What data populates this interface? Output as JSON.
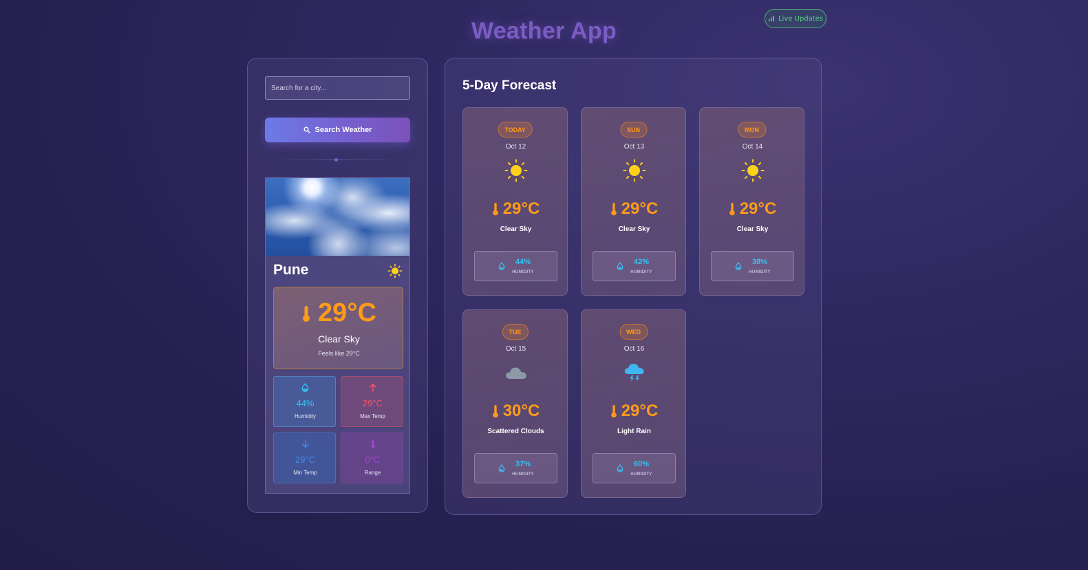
{
  "app": {
    "title": "Weather App",
    "live_badge": "Live Updates"
  },
  "search": {
    "placeholder": "Search for a city...",
    "button_label": "Search Weather"
  },
  "current": {
    "city": "Pune",
    "temperature": "29°C",
    "condition": "Clear Sky",
    "feels_like": "Feels like 29°C",
    "stats": {
      "humidity": {
        "value": "44%",
        "label": "Humidity"
      },
      "max_temp": {
        "value": "29°C",
        "label": "Max Temp"
      },
      "min_temp": {
        "value": "29°C",
        "label": "Min Temp"
      },
      "range": {
        "value": "0°C",
        "label": "Range"
      }
    }
  },
  "forecast": {
    "title": "5-Day Forecast",
    "humidity_label": "HUMIDITY",
    "days": [
      {
        "day": "TODAY",
        "date": "Oct 12",
        "icon": "sun-icon",
        "temp": "29°C",
        "desc": "Clear Sky",
        "humidity": "44%"
      },
      {
        "day": "SUN",
        "date": "Oct 13",
        "icon": "sun-icon",
        "temp": "29°C",
        "desc": "Clear Sky",
        "humidity": "42%"
      },
      {
        "day": "MON",
        "date": "Oct 14",
        "icon": "sun-icon",
        "temp": "29°C",
        "desc": "Clear Sky",
        "humidity": "38%"
      },
      {
        "day": "TUE",
        "date": "Oct 15",
        "icon": "cloud-icon",
        "temp": "30°C",
        "desc": "Scattered Clouds",
        "humidity": "37%"
      },
      {
        "day": "WED",
        "date": "Oct 16",
        "icon": "storm-cloud-icon",
        "temp": "29°C",
        "desc": "Light Rain",
        "humidity": "60%"
      }
    ]
  },
  "colors": {
    "accent": "#7b5cc4",
    "temperature": "#ff9b1a",
    "humidity": "#38c2f2",
    "live": "#5fce8f"
  }
}
